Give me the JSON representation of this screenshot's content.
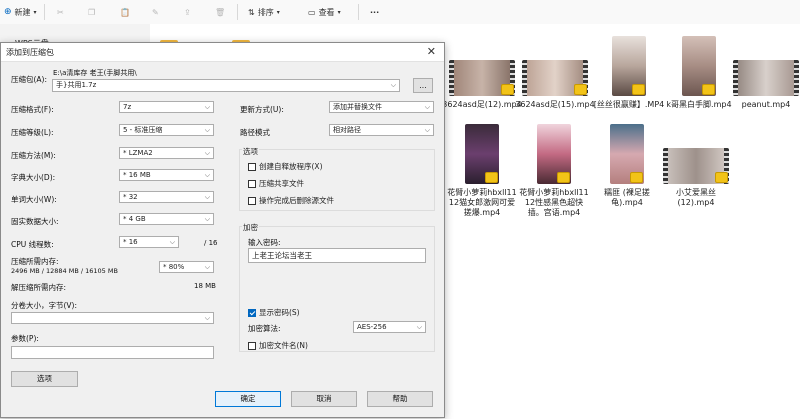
{
  "toolbar": {
    "new_label": "新建",
    "sort_label": "排序",
    "view_label": "查看",
    "more_label": "···"
  },
  "sidebar": {
    "cloud_label": "WPS云盘"
  },
  "files": [
    {
      "name": "3624asd足(12).mp4"
    },
    {
      "name": "3624asd足(15).mp4"
    },
    {
      "name": "[丝丝很赢赚】.MP4"
    },
    {
      "name": "k哥黑白手脚.mp4"
    },
    {
      "name": "peanut.mp4"
    },
    {
      "name": "花臂小萝莉hbxll1112猫女郎激网可爱搓爆.mp4"
    },
    {
      "name": "花臂小萝莉hbxll1112性感黑色超快插。宫语.mp4"
    },
    {
      "name": "糯匪 (裸足搓龟).mp4"
    },
    {
      "name": "小艾爱黑丝(12).mp4"
    }
  ],
  "dialog": {
    "title": "添加到压缩包",
    "close": "✕",
    "archive_label": "压缩包(A):",
    "archive_path": "E:\\a清库存 老王(手脚共用\\",
    "archive_name": "手}共用1.7z",
    "browse": "...",
    "format_label": "压缩格式(F):",
    "format_value": "7z",
    "level_label": "压缩等级(L):",
    "level_value": "5 - 标准压缩",
    "method_label": "压缩方法(M):",
    "method_value": "* LZMA2",
    "dict_label": "字典大小(D):",
    "dict_value": "* 16 MB",
    "word_label": "单词大小(W):",
    "word_value": "* 32",
    "solid_label": "固实数据大小:",
    "solid_value": "* 4 GB",
    "cpu_label": "CPU 线程数:",
    "cpu_value": "* 16",
    "cpu_total": "/ 16",
    "mem_label": "压缩所需内存:",
    "mem_values": "2496 MB / 12884 MB / 16105 MB",
    "mem_percent": "* 80%",
    "decomp_label": "解压缩所需内存:",
    "decomp_value": "18 MB",
    "split_label": "分卷大小，字节(V):",
    "split_value": "",
    "params_label": "参数(P):",
    "params_value": "",
    "options_button": "选项",
    "update_label": "更新方式(U):",
    "update_value": "添加并替换文件",
    "path_label": "路径模式",
    "path_value": "相对路径",
    "options_group": "选项",
    "opt_sfx": "创建自释放程序(X)",
    "opt_shared": "压缩共享文件",
    "opt_delete": "操作完成后删除源文件",
    "encrypt_group": "加密",
    "password_label": "输入密码:",
    "password_value": "上老王论坛当老王",
    "show_password": "显示密码(S)",
    "enc_method_label": "加密算法:",
    "enc_method_value": "AES-256",
    "enc_names": "加密文件名(N)",
    "ok": "确定",
    "cancel": "取消",
    "help": "帮助"
  }
}
